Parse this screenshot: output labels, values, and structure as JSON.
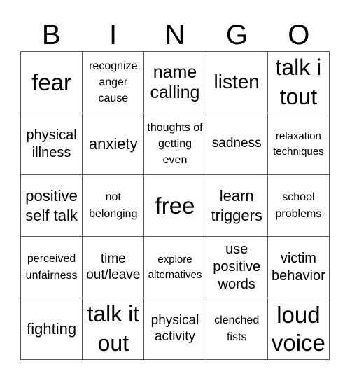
{
  "header": [
    "B",
    "I",
    "N",
    "G",
    "O"
  ],
  "cells": [
    {
      "text": "fear",
      "size": "s33"
    },
    {
      "text": "recognize anger cause",
      "size": "s16"
    },
    {
      "text": "name calling",
      "size": "s25"
    },
    {
      "text": "listen",
      "size": "s28"
    },
    {
      "text": "talk i tout",
      "size": "s32"
    },
    {
      "text": "physical illness",
      "size": "s20"
    },
    {
      "text": "anxiety",
      "size": "s22"
    },
    {
      "text": "thoughts of getting even",
      "size": "s16"
    },
    {
      "text": "sadness",
      "size": "s19"
    },
    {
      "text": "relaxation techniques",
      "size": "s15"
    },
    {
      "text": "positive self talk",
      "size": "s22"
    },
    {
      "text": "not belonging",
      "size": "s16"
    },
    {
      "text": "free",
      "size": "s33"
    },
    {
      "text": "learn triggers",
      "size": "s22"
    },
    {
      "text": "school problems",
      "size": "s16"
    },
    {
      "text": "perceived unfairness",
      "size": "s16"
    },
    {
      "text": "time out/leave",
      "size": "s19"
    },
    {
      "text": "explore alternatives",
      "size": "s15"
    },
    {
      "text": "use positive words",
      "size": "s20"
    },
    {
      "text": "victim behavior",
      "size": "s20"
    },
    {
      "text": "fighting",
      "size": "s22"
    },
    {
      "text": "talk it out",
      "size": "s32"
    },
    {
      "text": "physical activity",
      "size": "s19"
    },
    {
      "text": "clenched fists",
      "size": "s16"
    },
    {
      "text": "loud voice",
      "size": "s33"
    }
  ]
}
